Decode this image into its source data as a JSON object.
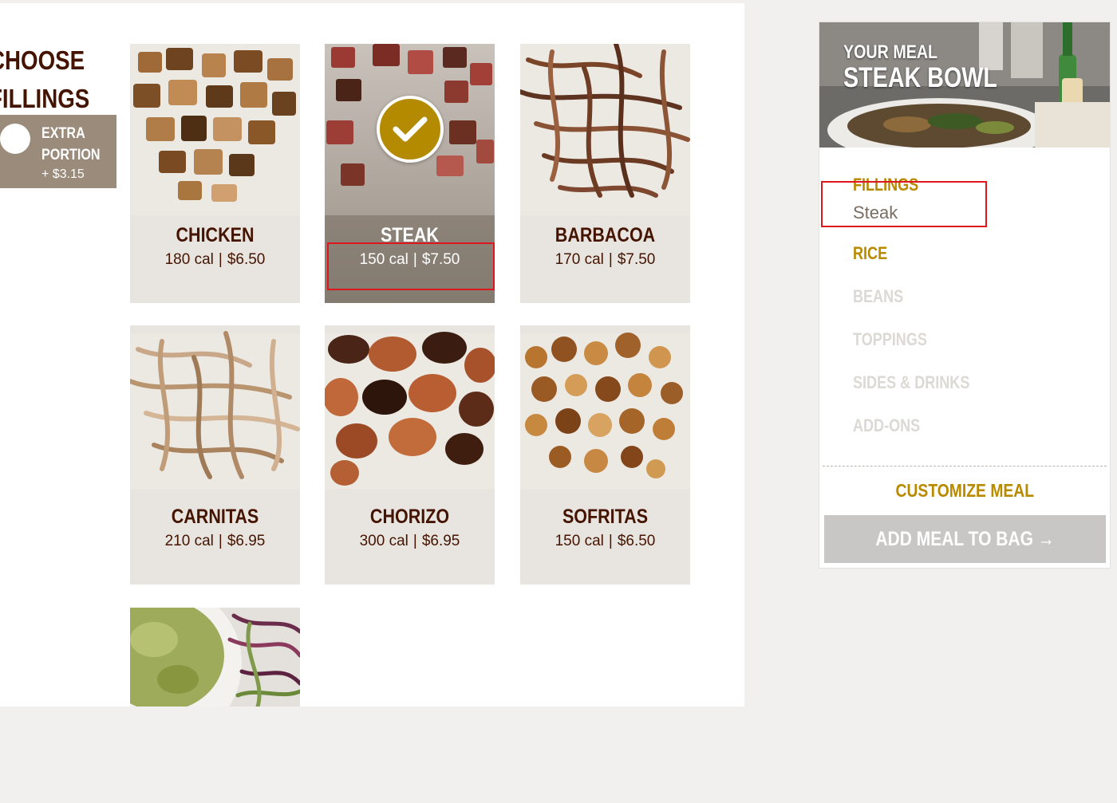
{
  "builder": {
    "heading_line1": "CHOOSE",
    "heading_line2": "FILLINGS",
    "extra_portion": {
      "label_line1": "EXTRA",
      "label_line2": "PORTION",
      "price": "+ $3.15"
    },
    "fillings": [
      {
        "name": "CHICKEN",
        "cal": "180 cal",
        "price": "$6.50",
        "selected": false
      },
      {
        "name": "STEAK",
        "cal": "150 cal",
        "price": "$7.50",
        "selected": true
      },
      {
        "name": "BARBACOA",
        "cal": "170 cal",
        "price": "$7.50",
        "selected": false
      },
      {
        "name": "CARNITAS",
        "cal": "210 cal",
        "price": "$6.95",
        "selected": false
      },
      {
        "name": "CHORIZO",
        "cal": "300 cal",
        "price": "$6.95",
        "selected": false
      },
      {
        "name": "SOFRITAS",
        "cal": "150 cal",
        "price": "$6.50",
        "selected": false
      }
    ],
    "separator": "|"
  },
  "meal": {
    "eyebrow": "YOUR MEAL",
    "title": "STEAK BOWL",
    "steps": {
      "fillings": "FILLINGS",
      "fillings_value": "Steak",
      "rice": "RICE",
      "beans": "BEANS",
      "toppings": "TOPPINGS",
      "sides": "SIDES & DRINKS",
      "addons": "ADD-ONS"
    },
    "customize_label": "CUSTOMIZE MEAL",
    "add_to_bag_label": "ADD MEAL TO BAG →"
  },
  "colors": {
    "brand_brown": "#451400",
    "accent_gold": "#b88a00",
    "annotation_red": "#e0161f"
  }
}
